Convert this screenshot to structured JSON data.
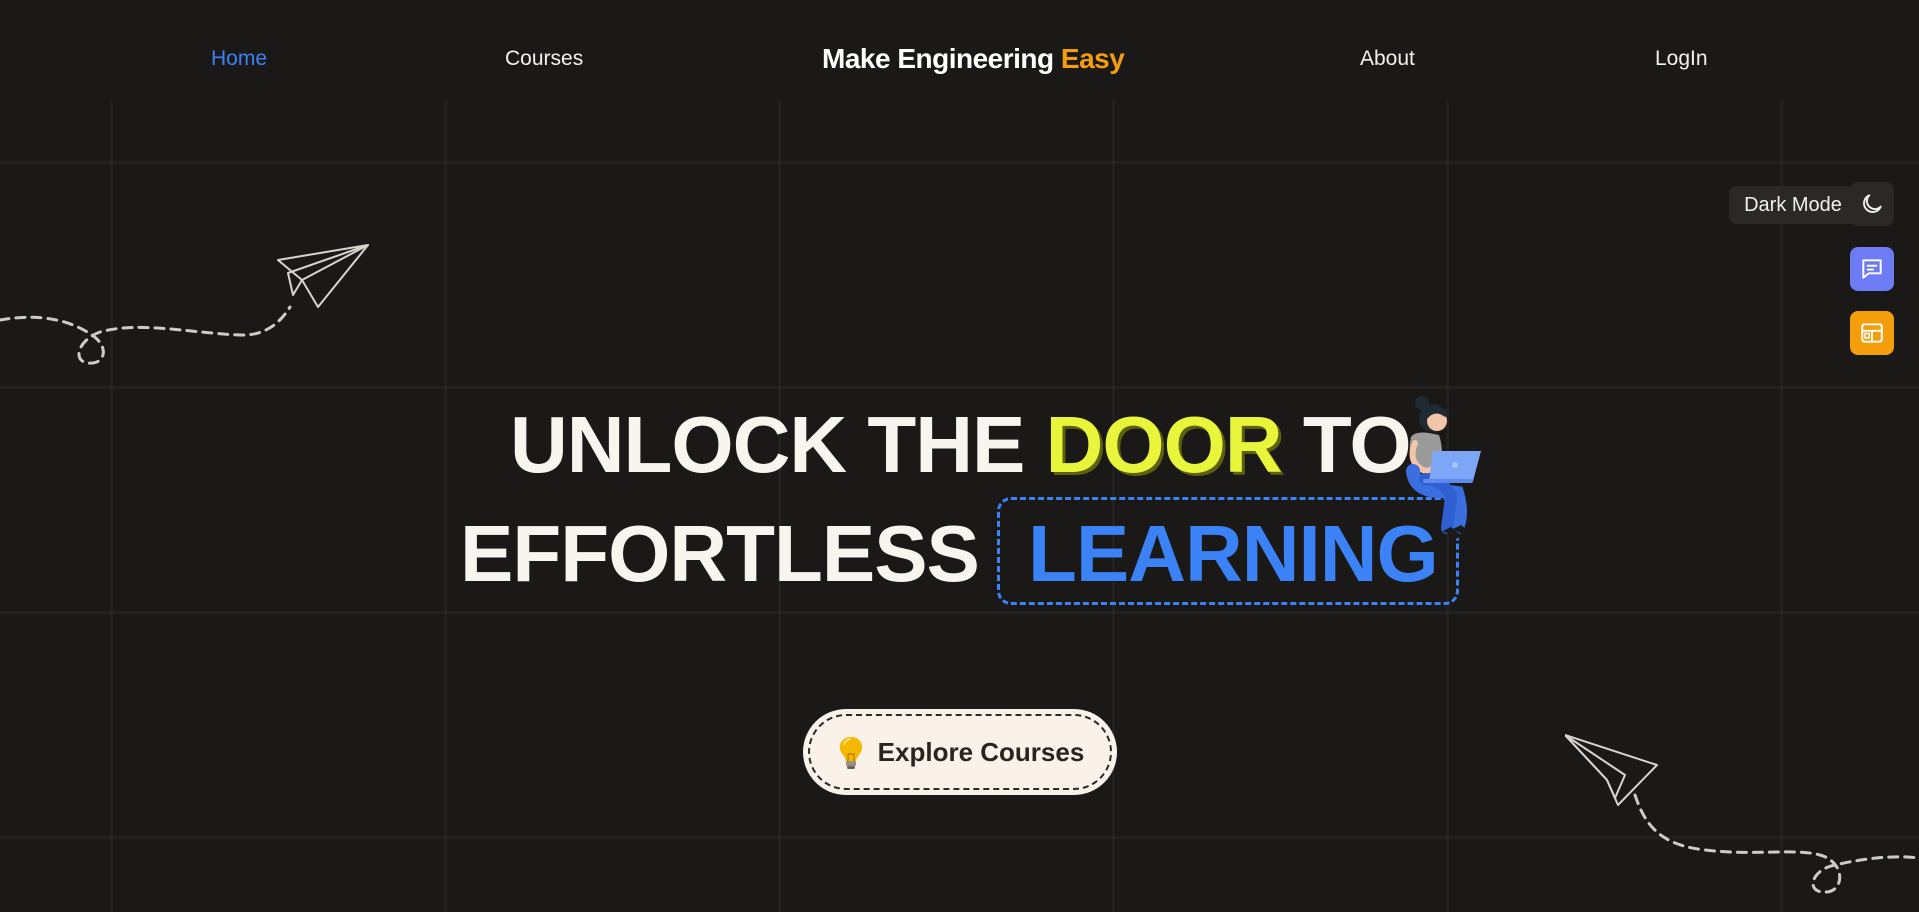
{
  "nav": {
    "home": "Home",
    "courses": "Courses",
    "about": "About",
    "login": "LogIn"
  },
  "brand": {
    "main": "Make Engineering",
    "accent": "Easy",
    "accent_color": "#f59e0b"
  },
  "side_tools": {
    "dark_mode_label": "Dark Mode",
    "icons": [
      "moon-icon",
      "chat-icon",
      "layout-icon"
    ]
  },
  "hero": {
    "line1_a": "UNLOCK THE",
    "line1_highlight": "DOOR",
    "line1_b": "TO",
    "line2_a": "EFFORTLESS",
    "line2_highlight": "LEARNING",
    "highlight_colors": {
      "door": "#e8f53a",
      "learning": "#3b82f6"
    }
  },
  "cta": {
    "label": "Explore Courses",
    "icon": "lightbulb-icon"
  },
  "colors": {
    "background": "#1a1918",
    "active_nav": "#3b82f6"
  }
}
